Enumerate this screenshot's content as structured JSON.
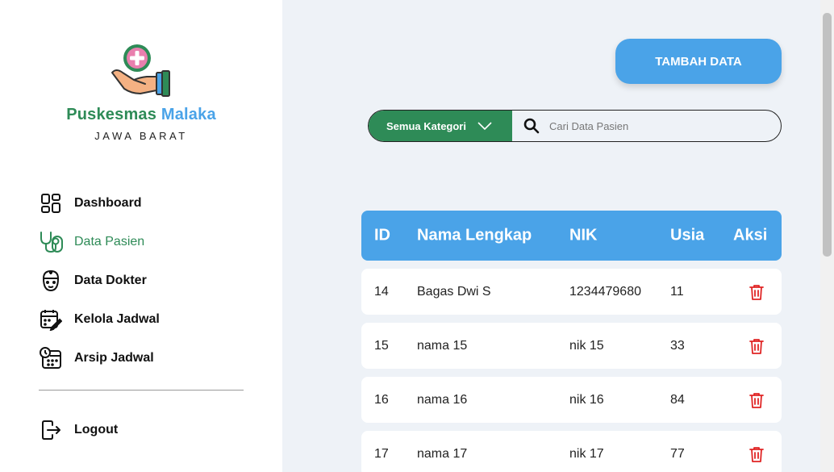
{
  "brand": {
    "name_part1": "Puskesmas",
    "name_part2": "Malaka",
    "subtitle": "JAWA BARAT"
  },
  "sidebar": {
    "items": [
      {
        "label": "Dashboard",
        "icon": "dashboard-icon",
        "active": false
      },
      {
        "label": "Data Pasien",
        "icon": "stethoscope-icon",
        "active": true
      },
      {
        "label": "Data Dokter",
        "icon": "doctor-icon",
        "active": false
      },
      {
        "label": "Kelola Jadwal",
        "icon": "calendar-edit-icon",
        "active": false
      },
      {
        "label": "Arsip Jadwal",
        "icon": "calendar-clock-icon",
        "active": false
      }
    ],
    "logout_label": "Logout"
  },
  "toolbar": {
    "add_label": "TAMBAH DATA"
  },
  "search": {
    "category_label": "Semua Kategori",
    "placeholder": "Cari Data Pasien"
  },
  "table": {
    "headers": [
      "ID",
      "Nama Lengkap",
      "NIK",
      "Usia",
      "Aksi"
    ],
    "rows": [
      {
        "id": "14",
        "nama": "Bagas Dwi S",
        "nik": "1234479680",
        "usia": "11"
      },
      {
        "id": "15",
        "nama": "nama 15",
        "nik": "nik 15",
        "usia": "33"
      },
      {
        "id": "16",
        "nama": "nama 16",
        "nik": "nik 16",
        "usia": "84"
      },
      {
        "id": "17",
        "nama": "nama 17",
        "nik": "nik 17",
        "usia": "77"
      }
    ]
  },
  "colors": {
    "primary_green": "#2e8b57",
    "primary_blue": "#4aa3e8",
    "delete_red": "#e02424",
    "background": "#eef2f7"
  }
}
